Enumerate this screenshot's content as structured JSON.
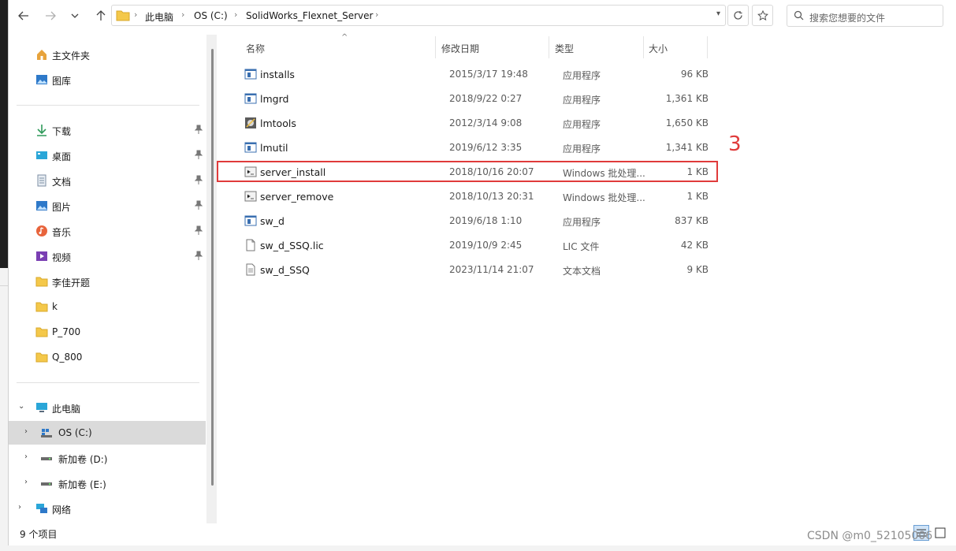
{
  "window": {
    "address": {
      "crumbs": [
        "此电脑",
        "OS (C:)",
        "SolidWorks_Flexnet_Server"
      ]
    },
    "search": {
      "placeholder": "搜索您想要的文件"
    }
  },
  "sidebar": {
    "quick": [
      {
        "label": "主文件夹",
        "icon": "home-icon"
      },
      {
        "label": "图库",
        "icon": "gallery-icon"
      }
    ],
    "pinned": [
      {
        "label": "下载",
        "icon": "download-icon",
        "pinned": true
      },
      {
        "label": "桌面",
        "icon": "desktop-icon",
        "pinned": true
      },
      {
        "label": "文档",
        "icon": "documents-icon",
        "pinned": true
      },
      {
        "label": "图片",
        "icon": "pictures-icon",
        "pinned": true
      },
      {
        "label": "音乐",
        "icon": "music-icon",
        "pinned": true
      },
      {
        "label": "视频",
        "icon": "videos-icon",
        "pinned": true
      },
      {
        "label": "李佳开题",
        "icon": "folder-icon",
        "pinned": false
      },
      {
        "label": "k",
        "icon": "folder-icon",
        "pinned": false
      },
      {
        "label": "P_700",
        "icon": "folder-icon",
        "pinned": false
      },
      {
        "label": "Q_800",
        "icon": "folder-icon",
        "pinned": false
      }
    ],
    "tree": [
      {
        "label": "此电脑",
        "icon": "computer-icon",
        "expanded": true
      },
      {
        "label": "OS (C:)",
        "icon": "os-drive-icon",
        "selected": true
      },
      {
        "label": "新加卷 (D:)",
        "icon": "drive-icon"
      },
      {
        "label": "新加卷 (E:)",
        "icon": "drive-icon"
      },
      {
        "label": "网络",
        "icon": "network-icon"
      }
    ]
  },
  "columns": {
    "name": "名称",
    "date": "修改日期",
    "type": "类型",
    "size": "大小"
  },
  "files": [
    {
      "name": "installs",
      "date": "2015/3/17 19:48",
      "type": "应用程序",
      "size": "96 KB",
      "icon": "exe-icon"
    },
    {
      "name": "lmgrd",
      "date": "2018/9/22 0:27",
      "type": "应用程序",
      "size": "1,361 KB",
      "icon": "exe-icon"
    },
    {
      "name": "lmtools",
      "date": "2012/3/14 9:08",
      "type": "应用程序",
      "size": "1,650 KB",
      "icon": "lmtools-icon"
    },
    {
      "name": "lmutil",
      "date": "2019/6/12 3:35",
      "type": "应用程序",
      "size": "1,341 KB",
      "icon": "exe-icon"
    },
    {
      "name": "server_install",
      "date": "2018/10/16 20:07",
      "type": "Windows 批处理...",
      "size": "1 KB",
      "icon": "batch-icon"
    },
    {
      "name": "server_remove",
      "date": "2018/10/13 20:31",
      "type": "Windows 批处理...",
      "size": "1 KB",
      "icon": "batch-icon"
    },
    {
      "name": "sw_d",
      "date": "2019/6/18 1:10",
      "type": "应用程序",
      "size": "837 KB",
      "icon": "exe-icon"
    },
    {
      "name": "sw_d_SSQ.lic",
      "date": "2019/10/9 2:45",
      "type": "LIC 文件",
      "size": "42 KB",
      "icon": "file-icon"
    },
    {
      "name": "sw_d_SSQ",
      "date": "2023/11/14 21:07",
      "type": "文本文档",
      "size": "9 KB",
      "icon": "text-file-icon"
    }
  ],
  "annotation": {
    "label": "3",
    "color": "#e03b3b"
  },
  "status": {
    "count": "9 个项目"
  },
  "watermark": "CSDN @m0_52105006"
}
